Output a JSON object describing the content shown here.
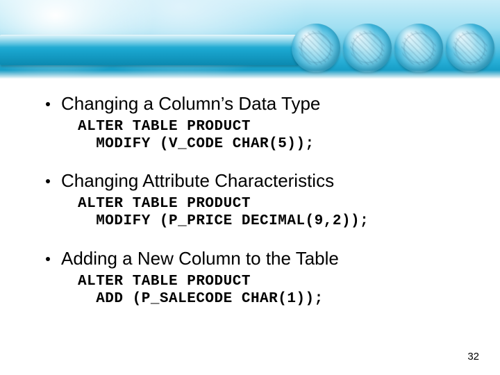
{
  "page_number": "32",
  "sections": [
    {
      "heading": "Changing a Column’s Data Type",
      "code_line1": "ALTER TABLE PRODUCT",
      "code_line2": "  MODIFY (V_CODE CHAR(5));"
    },
    {
      "heading": "Changing Attribute Characteristics",
      "code_line1": "ALTER TABLE PRODUCT",
      "code_line2": "  MODIFY (P_PRICE DECIMAL(9,2));"
    },
    {
      "heading": "Adding a New Column to the Table",
      "code_line1": "ALTER TABLE PRODUCT",
      "code_line2": "  ADD (P_SALECODE CHAR(1));"
    }
  ]
}
